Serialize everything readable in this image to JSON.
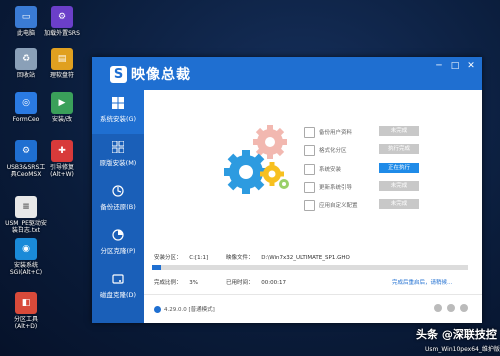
{
  "desktop": {
    "icons": [
      {
        "label": "此电脑",
        "icon": "computer-icon",
        "color": "#3a7bd5"
      },
      {
        "label": "加载外置SRS",
        "icon": "gear-icon",
        "color": "#6b3fc9"
      },
      {
        "label": "回收站",
        "icon": "recycle-bin-icon",
        "color": "#8aa0b8"
      },
      {
        "label": "理软盘符",
        "icon": "disk-icon",
        "color": "#e0a020"
      },
      {
        "label": "FormCeo",
        "icon": "formceo-icon",
        "color": "#2a7ae2"
      },
      {
        "label": "安装/改",
        "icon": "installer-icon",
        "color": "#3aa05a"
      },
      {
        "label": "USB3&SRS工具CeoMSX",
        "icon": "usb-gear-icon",
        "color": "#1f6fd1"
      },
      {
        "label": "引导修复(Alt+W)",
        "icon": "repair-icon",
        "color": "#d83a3a"
      },
      {
        "label": "USM_PE驱动安装日志.txt",
        "icon": "text-file-icon",
        "color": "#e8e8e8"
      },
      {
        "label": "安装系统SGI(Alt+C)",
        "icon": "install-system-icon",
        "color": "#1a8ad8"
      },
      {
        "label": "分区工具(Alt+D)",
        "icon": "partition-tool-icon",
        "color": "#d84a3a"
      }
    ]
  },
  "window": {
    "title": "映像总裁",
    "logo_letter": "S",
    "controls": [
      "─",
      "□",
      "✕"
    ]
  },
  "sidebar": {
    "items": [
      {
        "label": "系统安装(G)",
        "icon": "windows-icon",
        "active": true
      },
      {
        "label": "原版安装(M)",
        "icon": "grid-icon",
        "active": false
      },
      {
        "label": "备份还原(B)",
        "icon": "backup-icon",
        "active": false
      },
      {
        "label": "分区克隆(P)",
        "icon": "pie-icon",
        "active": false
      },
      {
        "label": "磁盘克隆(D)",
        "icon": "disk-clone-icon",
        "active": false
      }
    ]
  },
  "steps": [
    {
      "label": "备份用户资料",
      "status": "未完成",
      "running": false
    },
    {
      "label": "格式化分区",
      "status": "执行完成",
      "running": false
    },
    {
      "label": "系统安装",
      "status": "正在执行",
      "running": true
    },
    {
      "label": "更新系统引导",
      "status": "未完成",
      "running": false
    },
    {
      "label": "应用自定义配置",
      "status": "未完成",
      "running": false
    }
  ],
  "info": {
    "partition_label": "安装分区：",
    "partition_value": "C:[1:1]",
    "image_label": "映像文件：",
    "image_value": "D:\\Win7x32_ULTIMATE_SP1.GHO",
    "done_label": "完成比例：",
    "done_value": "3%",
    "time_label": "已用时间：",
    "time_value": "00:00:17",
    "after_action": "完成后重启后，请稍候…",
    "progress": 0.03
  },
  "footer": {
    "version": "4.29.0.0 [普通模式]"
  },
  "watermark": {
    "text": "头条 @深联技控",
    "os_line": "Usm_Win10pex64_维护版"
  }
}
